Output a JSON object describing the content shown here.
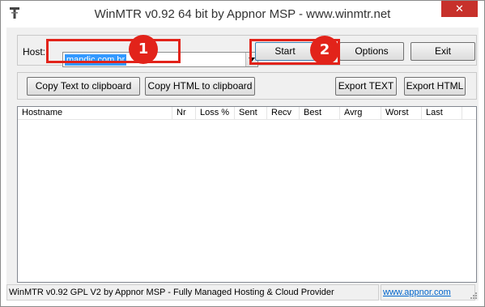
{
  "window": {
    "title": "WinMTR v0.92 64 bit by Appnor MSP - www.winmtr.net",
    "close_glyph": "✕"
  },
  "host": {
    "label": "Host:",
    "value": "mandic.com.br"
  },
  "buttons": {
    "start": "Start",
    "options": "Options",
    "exit": "Exit",
    "copy_text": "Copy Text to clipboard",
    "copy_html": "Copy HTML to clipboard",
    "export_text": "Export TEXT",
    "export_html": "Export HTML"
  },
  "table": {
    "columns": [
      "Hostname",
      "Nr",
      "Loss %",
      "Sent",
      "Recv",
      "Best",
      "Avrg",
      "Worst",
      "Last"
    ],
    "rows": []
  },
  "status": {
    "text": "WinMTR v0.92 GPL V2 by Appnor MSP - Fully Managed Hosting & Cloud Provider",
    "link": "www.appnor.com"
  },
  "annotations": {
    "step1": "1",
    "step2": "2",
    "color": "#e2231a"
  }
}
